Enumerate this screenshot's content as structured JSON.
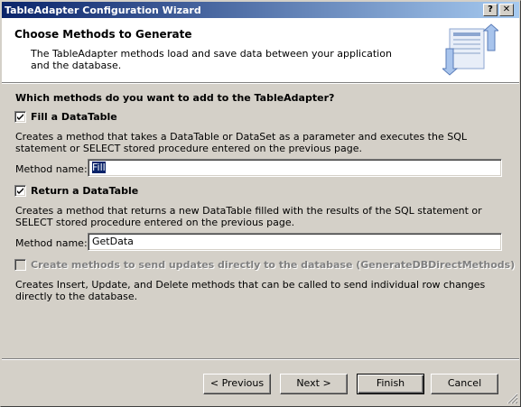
{
  "window": {
    "title": "TableAdapter Configuration Wizard",
    "help_glyph": "?",
    "close_glyph": "✕"
  },
  "header": {
    "title": "Choose Methods to Generate",
    "description": "The TableAdapter methods load and save data between your application and the database.",
    "icon": "wizard-database-icon"
  },
  "content": {
    "question": "Which methods do you want to add to the TableAdapter?",
    "fill": {
      "checked": true,
      "label": "Fill a DataTable",
      "description": "Creates a method that takes a DataTable or DataSet as a parameter and executes the SQL statement or SELECT stored procedure entered on the previous page.",
      "method_label": "Method name:",
      "method_value": "Fill"
    },
    "return": {
      "checked": true,
      "label": "Return a DataTable",
      "description": "Creates a method that returns a new DataTable filled with the results of the SQL statement or SELECT stored procedure entered on the previous page.",
      "method_label": "Method name:",
      "method_value": "GetData"
    },
    "direct": {
      "checked": false,
      "disabled": true,
      "label": "Create methods to send updates directly to the database (GenerateDBDirectMethods)",
      "description": "Creates Insert, Update, and Delete methods that can be called to send individual row changes directly to the database."
    }
  },
  "footer": {
    "previous_label": "< Previous",
    "next_label": "Next >",
    "finish_label": "Finish",
    "cancel_label": "Cancel"
  },
  "colors": {
    "titlebar_start": "#0a246a",
    "titlebar_end": "#a6caf0",
    "face": "#d4d0c8"
  }
}
